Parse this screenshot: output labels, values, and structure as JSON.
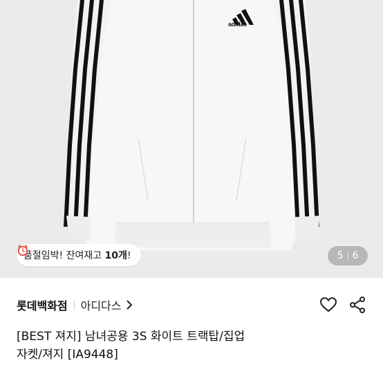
{
  "product": {
    "image_alt": "adidas white track top",
    "brand_mark": "adidas",
    "urgency_badge": {
      "prefix": "품절임박! 잔여재고 ",
      "count": "10개",
      "suffix": "!"
    },
    "image_counter": {
      "current": "5",
      "total": "6"
    },
    "store_name": "롯데백화점",
    "brand_name": "아디다스",
    "title_line1": "[BEST 져지] 남녀공용 3S 화이트 트랙탑/집업",
    "title_line2": "자켓/져지 [IA9448]"
  },
  "icons": {
    "alarm": "alarm-clock-icon",
    "chevron": "chevron-right-icon",
    "like": "heart-icon",
    "share": "share-icon"
  },
  "colors": {
    "stripe": "#111111",
    "jacket": "#f7f7f7",
    "background": "#ebebeb",
    "alarm": "#e5473a"
  }
}
